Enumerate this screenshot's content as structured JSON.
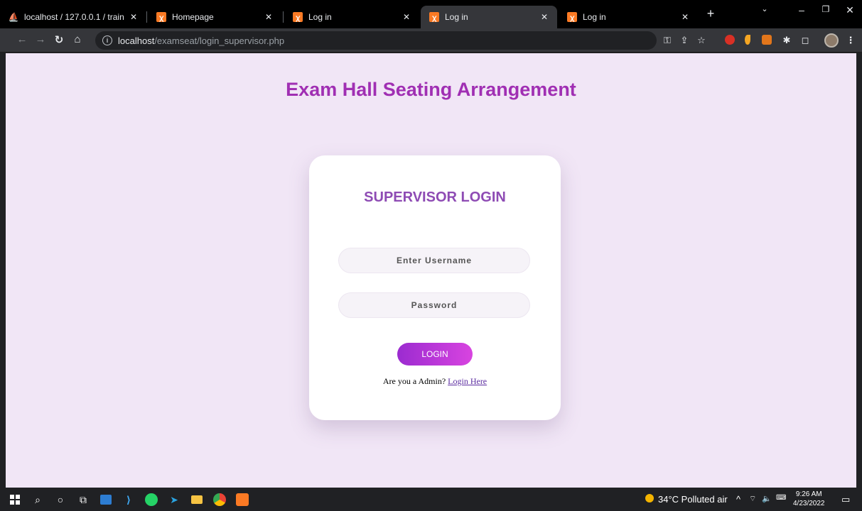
{
  "browser": {
    "tabs": [
      {
        "title": "localhost / 127.0.0.1 / train |",
        "favicon": "phpmyadmin-icon"
      },
      {
        "title": "Homepage",
        "favicon": "xampp-icon"
      },
      {
        "title": "Log in",
        "favicon": "xampp-icon"
      },
      {
        "title": "Log in",
        "favicon": "xampp-icon"
      },
      {
        "title": "Log in",
        "favicon": "xampp-icon"
      }
    ],
    "active_tab_index": 3,
    "url_host": "localhost",
    "url_path": "/examseat/login_supervisor.php"
  },
  "page": {
    "title": "Exam Hall Seating Arrangement",
    "card_title": "SUPERVISOR LOGIN",
    "username_placeholder": "Enter Username",
    "password_placeholder": "Password",
    "login_button": "LOGIN",
    "admin_prompt": "Are you a Admin?",
    "admin_link": "Login Here"
  },
  "colors": {
    "page_bg": "#f1e6f6",
    "title": "#a02fb3",
    "card_title": "#8e4bb4",
    "button_gradient_start": "#9b2bd0",
    "button_gradient_end": "#d844e0"
  },
  "taskbar": {
    "weather": "34°C  Polluted air",
    "time": "9:26 AM",
    "date": "4/23/2022"
  }
}
